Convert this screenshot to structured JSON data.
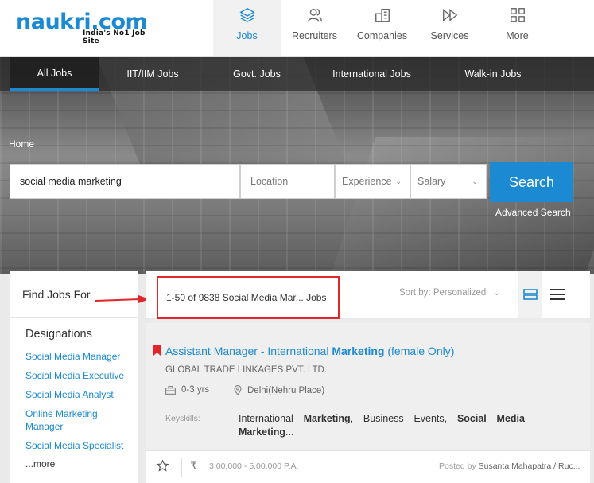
{
  "header": {
    "logo_text": "naukri.com",
    "logo_tagline": "India's No1 Job Site",
    "nav": [
      {
        "label": "Jobs",
        "icon": "layers-icon",
        "active": true
      },
      {
        "label": "Recruiters",
        "icon": "users-icon",
        "active": false
      },
      {
        "label": "Companies",
        "icon": "building-icon",
        "active": false
      },
      {
        "label": "Services",
        "icon": "forward-icon",
        "active": false
      },
      {
        "label": "More",
        "icon": "grid-icon",
        "active": false
      }
    ]
  },
  "subnav": [
    {
      "label": "All Jobs",
      "active": true
    },
    {
      "label": "IIT/IIM Jobs",
      "active": false
    },
    {
      "label": "Govt. Jobs",
      "active": false
    },
    {
      "label": "International Jobs",
      "active": false
    },
    {
      "label": "Walk-in Jobs",
      "active": false
    }
  ],
  "breadcrumb": "Home",
  "search": {
    "keyword_value": "social media marketing",
    "location_placeholder": "Location",
    "experience_placeholder": "Experience",
    "salary_placeholder": "Salary",
    "button_label": "Search",
    "advanced_label": "Advanced Search"
  },
  "left_panel": {
    "header": "Find Jobs For",
    "group_title": "Designations",
    "links": [
      "Social Media Manager",
      "Social Media Executive",
      "Social Media Analyst",
      "Online Marketing Manager",
      "Social Media Specialist"
    ],
    "more_label": "...more"
  },
  "results": {
    "count_text": "1-50 of 9838 Social Media Mar... Jobs",
    "sort_label": "Sort by:",
    "sort_value": "Personalized"
  },
  "job": {
    "title_pre": "Assistant Manager - International ",
    "title_bold": "Marketing",
    "title_post": " (female Only)",
    "company": "GLOBAL TRADE LINKAGES PVT. LTD.",
    "experience": "0-3 yrs",
    "location": "Delhi(Nehru Place)",
    "keyskills_label": "Keyskills:",
    "skills_p1": "International ",
    "skills_b1": "Marketing",
    "skills_p2": ", Business Events, ",
    "skills_b2": "Social Media Marketing",
    "skills_p3": "...",
    "salary": "3,00,000 - 5,00,000 P.A.",
    "rupee_symbol": "₹",
    "posted_by_label": "Posted by",
    "posted_by_name": "Susanta Mahapatra / Ruc..."
  },
  "colors": {
    "accent": "#1b8ad3",
    "highlight_box": "#e0262a"
  }
}
